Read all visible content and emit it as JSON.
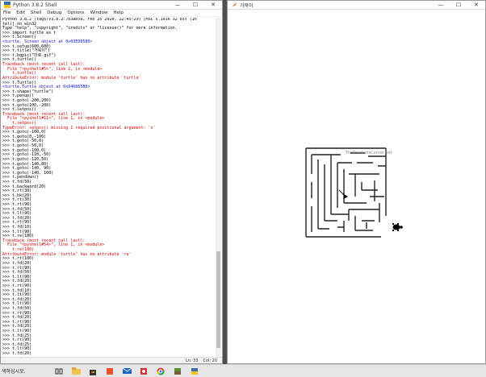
{
  "shell": {
    "title": "Python 3.8.2 Shell",
    "menu": [
      "File",
      "Edit",
      "Shell",
      "Debug",
      "Options",
      "Window",
      "Help"
    ],
    "lines": [
      {
        "t": "Python 3.8.2 (tags/v3.8.2:7b3ab59, Feb 25 2020, 22:45:29) [MSC v.1916 32 bit (In",
        "c": "black"
      },
      {
        "t": "tel)] on win32",
        "c": "black"
      },
      {
        "t": "Type \"help\", \"copyright\", \"credits\" or \"license()\" for more information.",
        "c": "black"
      },
      {
        "t": ">>> import turtle as t",
        "c": "black"
      },
      {
        "t": ">>> t.Screen()",
        "c": "black"
      },
      {
        "t": "<turtle._Screen object at 0x03ED6580>",
        "c": "blue"
      },
      {
        "t": ">>> t.setup(600,600)",
        "c": "black"
      },
      {
        "t": ">>> t.title(\"거북이\")",
        "c": "black"
      },
      {
        "t": ">>> t.bgpic(\"미로.gif\")",
        "c": "black"
      },
      {
        "t": ">>> t.turtle()",
        "c": "black"
      },
      {
        "t": "Traceback (most recent call last):",
        "c": "red"
      },
      {
        "t": "  File \"<pyshell#5>\", line 1, in <module>",
        "c": "red"
      },
      {
        "t": "    t.turtle()",
        "c": "red"
      },
      {
        "t": "AttributeError: module 'turtle' has no attribute 'turtle'",
        "c": "red"
      },
      {
        "t": ">>> t.Turtle()",
        "c": "black"
      },
      {
        "t": "<turtle.Turtle object at 0x046865B0>",
        "c": "blue"
      },
      {
        "t": ">>> t.shape(\"turtle\")",
        "c": "black"
      },
      {
        "t": ">>> t.penup()",
        "c": "black"
      },
      {
        "t": ">>> t.goto(-200,200)",
        "c": "black"
      },
      {
        "t": ">>> t.goto(100,-200)",
        "c": "black"
      },
      {
        "t": ">>> t.setpos()",
        "c": "black"
      },
      {
        "t": "Traceback (most recent call last):",
        "c": "red"
      },
      {
        "t": "  File \"<pyshell#11>\", line 1, in <module>",
        "c": "red"
      },
      {
        "t": "    t.setpos()",
        "c": "red"
      },
      {
        "t": "TypeError: setpos() missing 1 required positional argument: 'x'",
        "c": "red"
      },
      {
        "t": ">>> t.goto(-100,0)",
        "c": "black"
      },
      {
        "t": ">>> t.goto(0,-100)",
        "c": "black"
      },
      {
        "t": ">>> t.goto(-50,0)",
        "c": "black"
      },
      {
        "t": ">>> t.goto(-50,0)",
        "c": "black"
      },
      {
        "t": ">>> t.goto(-100,0)",
        "c": "black"
      },
      {
        "t": ">>> t.goto(-110,-50)",
        "c": "black"
      },
      {
        "t": ">>> t.goto(-120,50)",
        "c": "black"
      },
      {
        "t": ">>> t.goto(-140,80)",
        "c": "black"
      },
      {
        "t": ">>> t.goto(-140, 90)",
        "c": "black"
      },
      {
        "t": ">>> t.goto(-140, 100)",
        "c": "black"
      },
      {
        "t": ">>> t.pendown()",
        "c": "black"
      },
      {
        "t": ">>> t.fd(50)",
        "c": "black"
      },
      {
        "t": ">>> t.backward(20)",
        "c": "black"
      },
      {
        "t": ">>> t.rt(30)",
        "c": "black"
      },
      {
        "t": ">>> t.bk(20)",
        "c": "black"
      },
      {
        "t": ">>> t.rt(30)",
        "c": "black"
      },
      {
        "t": ">>> t.rt(90)",
        "c": "black"
      },
      {
        "t": ">>> t.fd(50)",
        "c": "black"
      },
      {
        "t": ">>> t.lt(90)",
        "c": "black"
      },
      {
        "t": ">>> t.fd(20)",
        "c": "black"
      },
      {
        "t": ">>> t.rt(90)",
        "c": "black"
      },
      {
        "t": ">>> t.fd(10)",
        "c": "black"
      },
      {
        "t": ">>> t.lt(90)",
        "c": "black"
      },
      {
        "t": ">>> t.re(180)",
        "c": "black"
      },
      {
        "t": "Traceback (most recent call last):",
        "c": "red"
      },
      {
        "t": "  File \"<pyshell#54>\", line 1, in <module>",
        "c": "red"
      },
      {
        "t": "    t.re(180)",
        "c": "red"
      },
      {
        "t": "AttributeError: module 'turtle' has no attribute 're'",
        "c": "red"
      },
      {
        "t": ">>> t.rt(180)",
        "c": "black"
      },
      {
        "t": ">>> t.fd(20)",
        "c": "black"
      },
      {
        "t": ">>> t.rt(90)",
        "c": "black"
      },
      {
        "t": ">>> t.fd(50)",
        "c": "black"
      },
      {
        "t": ">>> t.lt(90)",
        "c": "black"
      },
      {
        "t": ">>> t.fd(20)",
        "c": "black"
      },
      {
        "t": ">>> t.rt(90)",
        "c": "black"
      },
      {
        "t": ">>> t.fd(10)",
        "c": "black"
      },
      {
        "t": ">>> t.lt(90)",
        "c": "black"
      },
      {
        "t": ">>> t.fd(20)",
        "c": "black"
      },
      {
        "t": ">>> t.lt(90)",
        "c": "black"
      },
      {
        "t": ">>> t.fd(50)",
        "c": "black"
      },
      {
        "t": ">>> t.rt(90)",
        "c": "black"
      },
      {
        "t": ">>> t.fd(20)",
        "c": "black"
      },
      {
        "t": ">>> t.rt(90)",
        "c": "black"
      },
      {
        "t": ">>> t.fd(20)",
        "c": "black"
      },
      {
        "t": ">>> t.lt(90)",
        "c": "black"
      },
      {
        "t": ">>> t.fd(25)",
        "c": "black"
      },
      {
        "t": ">>> t.rt(90)",
        "c": "black"
      },
      {
        "t": ">>> t.fd(25)",
        "c": "black"
      },
      {
        "t": ">>> t.lt(90)",
        "c": "black"
      },
      {
        "t": ">>> t.fd(20)",
        "c": "black"
      }
    ],
    "status": {
      "line": "Ln: 33",
      "col": "Col: 20"
    }
  },
  "turtle_window": {
    "title": "거북이",
    "watermark": "TheTeachersCorner.net"
  },
  "taskbar": {
    "search_text": "색하십시오.",
    "apps": [
      "task-view-icon",
      "file-explorer-icon",
      "store-icon",
      "office-icon",
      "mail-icon",
      "acrobat-icon",
      "chrome-icon",
      "minecraft-icon",
      "python-icon"
    ]
  }
}
